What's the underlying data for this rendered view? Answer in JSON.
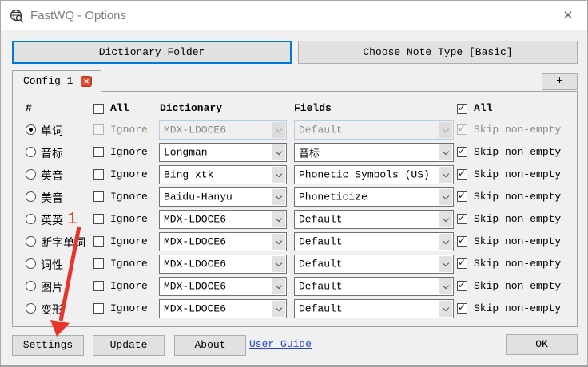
{
  "window": {
    "title": "FastWQ - Options"
  },
  "icons": {
    "close": "✕",
    "tab_close": "✕",
    "check": "✓"
  },
  "toolbar": {
    "dictionary_folder": "Dictionary Folder",
    "choose_note_type": "Choose Note Type [Basic]"
  },
  "tabs": {
    "active": "Config 1",
    "add": "+"
  },
  "table": {
    "col_hash": "#",
    "col_all_left": "All",
    "col_dictionary": "Dictionary",
    "col_fields": "Fields",
    "col_all_right": "All",
    "header_all_left_checked": false,
    "header_all_right_checked": true,
    "ignore_label": "Ignore",
    "skip_label": "Skip non-empty",
    "rows": [
      {
        "label": "单词",
        "dictionary": "MDX-LDOCE6",
        "field": "Default",
        "selected": true,
        "row_disabled": true,
        "ignore_checked": false,
        "skip_checked": true
      },
      {
        "label": "音标",
        "dictionary": "Longman",
        "field": "音标",
        "selected": false,
        "row_disabled": false,
        "ignore_checked": false,
        "skip_checked": true
      },
      {
        "label": "英音",
        "dictionary": "Bing xtk",
        "field": "Phonetic Symbols (US)",
        "selected": false,
        "row_disabled": false,
        "ignore_checked": false,
        "skip_checked": true
      },
      {
        "label": "美音",
        "dictionary": "Baidu-Hanyu",
        "field": "Phoneticize",
        "selected": false,
        "row_disabled": false,
        "ignore_checked": false,
        "skip_checked": true
      },
      {
        "label": "英英",
        "dictionary": "MDX-LDOCE6",
        "field": "Default",
        "selected": false,
        "row_disabled": false,
        "ignore_checked": false,
        "skip_checked": true
      },
      {
        "label": "断字单词",
        "dictionary": "MDX-LDOCE6",
        "field": "Default",
        "selected": false,
        "row_disabled": false,
        "ignore_checked": false,
        "skip_checked": true
      },
      {
        "label": "词性",
        "dictionary": "MDX-LDOCE6",
        "field": "Default",
        "selected": false,
        "row_disabled": false,
        "ignore_checked": false,
        "skip_checked": true
      },
      {
        "label": "图片",
        "dictionary": "MDX-LDOCE6",
        "field": "Default",
        "selected": false,
        "row_disabled": false,
        "ignore_checked": false,
        "skip_checked": true
      },
      {
        "label": "变形",
        "dictionary": "MDX-LDOCE6",
        "field": "Default",
        "selected": false,
        "row_disabled": false,
        "ignore_checked": false,
        "skip_checked": true
      }
    ]
  },
  "annotation": {
    "number": "1"
  },
  "footer": {
    "settings": "Settings",
    "update": "Update",
    "about": "About",
    "user_guide": "User Guide",
    "ok": "OK"
  },
  "colors": {
    "focus_blue": "#0078d7",
    "annotation_red": "#e8352b",
    "link_blue": "#2747d0",
    "tab_close_red": "#dd4a32",
    "disabled_text": "#8a8a8a"
  }
}
